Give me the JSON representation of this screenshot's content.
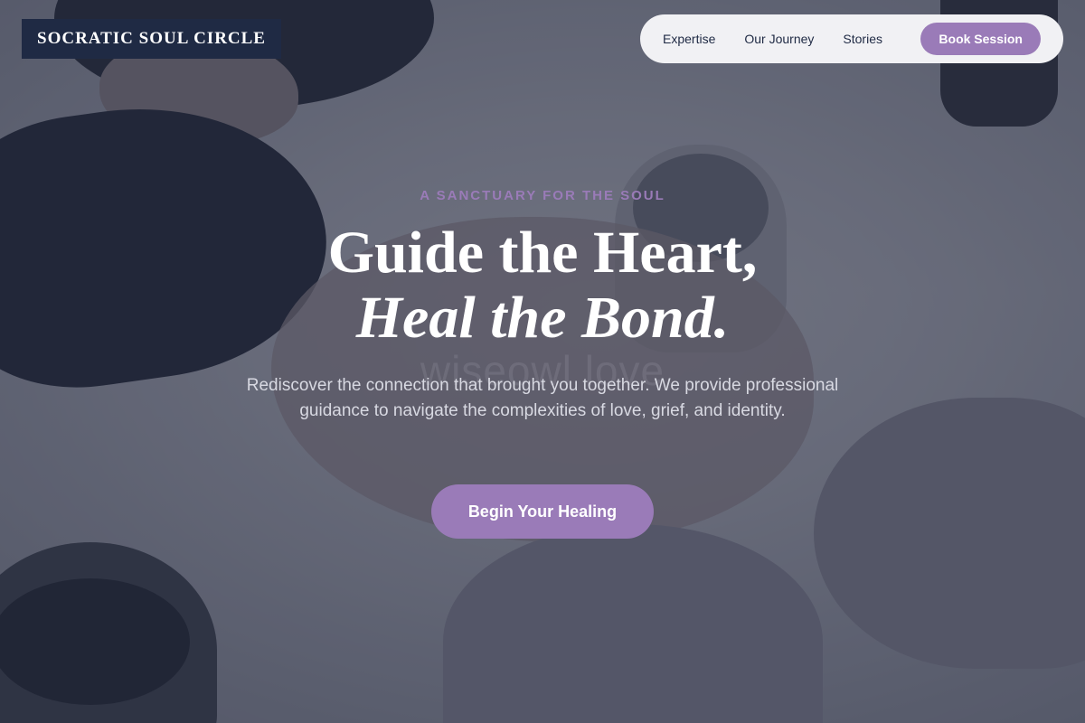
{
  "brand": {
    "name": "SOCRATIC SOUL CIRCLE"
  },
  "nav": {
    "items": [
      {
        "label": "Expertise"
      },
      {
        "label": "Our Journey"
      },
      {
        "label": "Stories"
      }
    ],
    "cta_label": "Book Session"
  },
  "hero": {
    "eyebrow": "A SANCTUARY FOR THE SOUL",
    "headline_line1": "Guide the Heart,",
    "headline_line2": "Heal the Bond.",
    "watermark": "wiseowl love",
    "subtext": "Rediscover the connection that brought you together. We provide professional guidance to navigate the complexities of love, grief, and identity.",
    "cta_label": "Begin Your Healing"
  },
  "colors": {
    "accent": "#9a7bb8",
    "navy": "#1f2a44",
    "nav_bg": "#f1f1f4"
  }
}
